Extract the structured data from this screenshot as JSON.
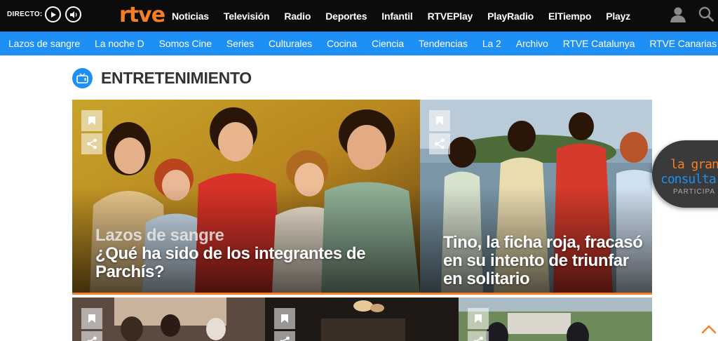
{
  "header": {
    "live_label": "DIRECTO:",
    "logo_text": "rtve",
    "nav": [
      "Noticias",
      "Televisión",
      "Radio",
      "Deportes",
      "Infantil",
      "RTVEPlay",
      "PlayRadio",
      "ElTiempo",
      "Playz"
    ],
    "icons": {
      "play": "play-icon",
      "radio": "speaker-icon",
      "user": "user-icon",
      "search": "search-icon"
    }
  },
  "subnav": [
    "Lazos de sangre",
    "La noche D",
    "Somos Cine",
    "Series",
    "Culturales",
    "Cocina",
    "Ciencia",
    "Tendencias",
    "La 2",
    "Archivo",
    "RTVE Catalunya",
    "RTVE Canarias"
  ],
  "section": {
    "title": "ENTRETENIMIENTO",
    "icon": "tv-icon"
  },
  "cards": {
    "big": {
      "kicker": "Lazos de sangre",
      "headline": "¿Qué ha sido de los integrantes de Parchís?"
    },
    "right": {
      "headline": "Tino, la ficha roja, fracasó en su intento de triunfar en solitario"
    }
  },
  "promo": {
    "line1": "la gran",
    "line2": "consulta",
    "line3": "PARTICIPA"
  },
  "colors": {
    "brand_orange": "#f47f25",
    "brand_blue": "#1d8ff5",
    "topbar": "#0c0c0c"
  }
}
